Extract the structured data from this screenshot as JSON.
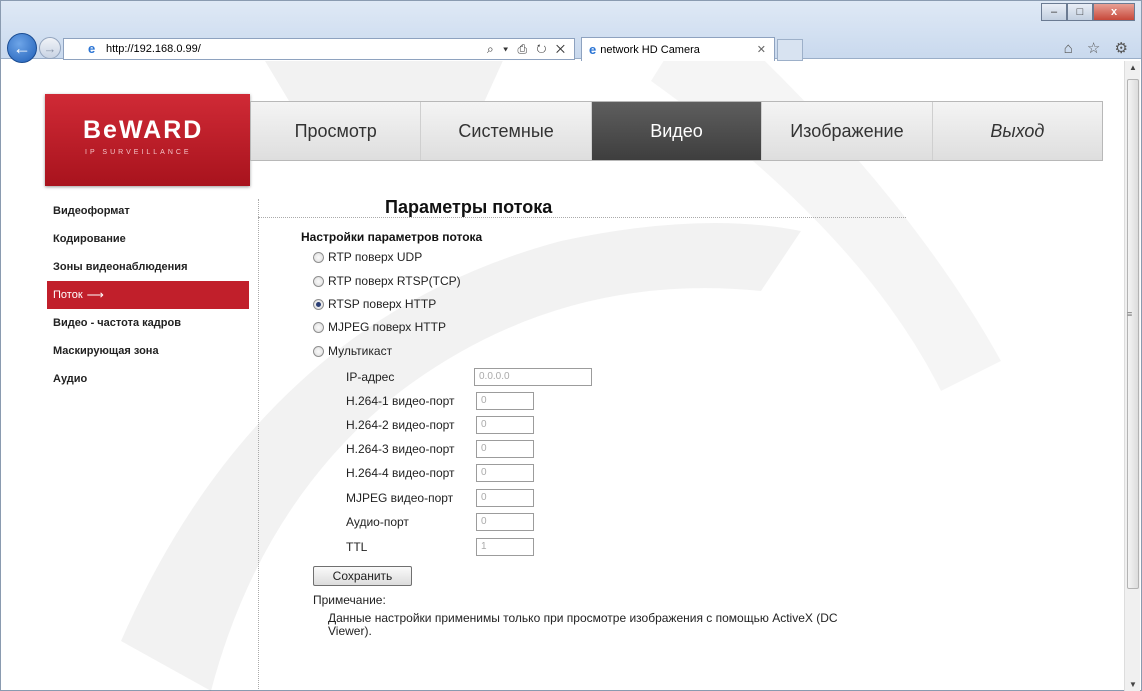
{
  "browser": {
    "url": "http://192.168.0.99/",
    "tab_title": "network HD Camera",
    "address_tools": "⌕ ▾ ⎙ ↻ ✕",
    "window_buttons": {
      "minimize": "–",
      "maximize": "□",
      "close": "x"
    },
    "toolbar_icons": "⌂ ☆ ⚙"
  },
  "logo": {
    "brand": "BeWARD",
    "sub": "IP SURVEILLANCE"
  },
  "menu": [
    "Просмотр",
    "Системные",
    "Видео",
    "Изображение",
    "Выход"
  ],
  "sidebar": [
    {
      "label": "Видеоформат"
    },
    {
      "label": "Кодирование"
    },
    {
      "label": "Зоны видеонаблюдения"
    },
    {
      "label": "Поток"
    },
    {
      "label": "Видео - частота кадров"
    },
    {
      "label": "Маскирующая зона"
    },
    {
      "label": "Аудио"
    }
  ],
  "page": {
    "title": "Параметры потока",
    "section": "Настройки параметров потока",
    "options": [
      {
        "label": "RTP поверх UDP",
        "selected": false
      },
      {
        "label": "RTP поверх RTSP(TCP)",
        "selected": false
      },
      {
        "label": "RTSP поверх HTTP",
        "selected": true
      },
      {
        "label": "MJPEG поверх HTTP",
        "selected": false
      },
      {
        "label": "Мультикаст",
        "selected": false
      }
    ],
    "fields": [
      {
        "label": "IP-адрес",
        "value": "0.0.0.0"
      },
      {
        "label": "H.264-1 видео-порт",
        "value": "0"
      },
      {
        "label": "H.264-2 видео-порт",
        "value": "0"
      },
      {
        "label": "H.264-3 видео-порт",
        "value": "0"
      },
      {
        "label": "H.264-4 видео-порт",
        "value": "0"
      },
      {
        "label": "MJPEG видео-порт",
        "value": "0"
      },
      {
        "label": "Аудио-порт",
        "value": "0"
      },
      {
        "label": "TTL",
        "value": "1"
      }
    ],
    "save_label": "Сохранить",
    "note_label": "Примечание:",
    "note_text": "Данные настройки применимы только при просмотре изображения с помощью ActiveX (DC Viewer)."
  },
  "colors": {
    "accent": "#c11f2b",
    "menu_active": "#4a4a4a"
  }
}
